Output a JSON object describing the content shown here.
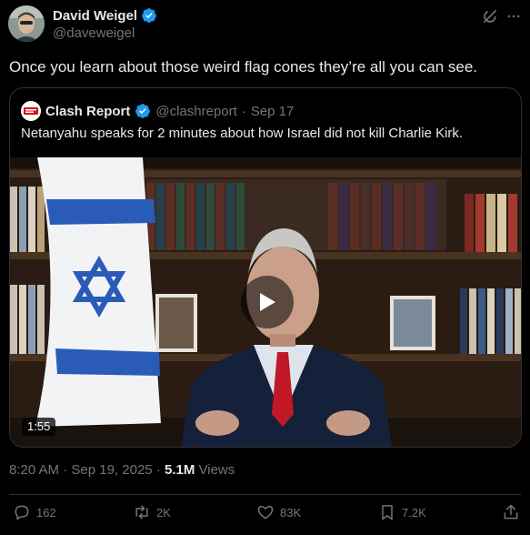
{
  "author": {
    "display_name": "David Weigel",
    "handle": "@daveweigel"
  },
  "tweet": {
    "text": "Once you learn about those weird flag cones they’re all you can see."
  },
  "quote": {
    "display_name": "Clash Report",
    "handle": "@clashreport",
    "separator": "·",
    "date": "Sep 17",
    "text": "Netanyahu speaks for 2 minutes about how Israel did not kill Charlie Kirk.",
    "video": {
      "duration": "1:55"
    }
  },
  "meta": {
    "time": "8:20 AM",
    "separator": "·",
    "date": "Sep 19, 2025",
    "views_count": "5.1M",
    "views_label": "Views"
  },
  "actions": {
    "replies": "162",
    "reposts": "2K",
    "likes": "83K",
    "bookmarks": "7.2K"
  },
  "colors": {
    "background": "#000000",
    "text": "#e7e9ea",
    "secondary": "#71767b",
    "border": "#2f3336",
    "verified": "#1d9bf0"
  }
}
